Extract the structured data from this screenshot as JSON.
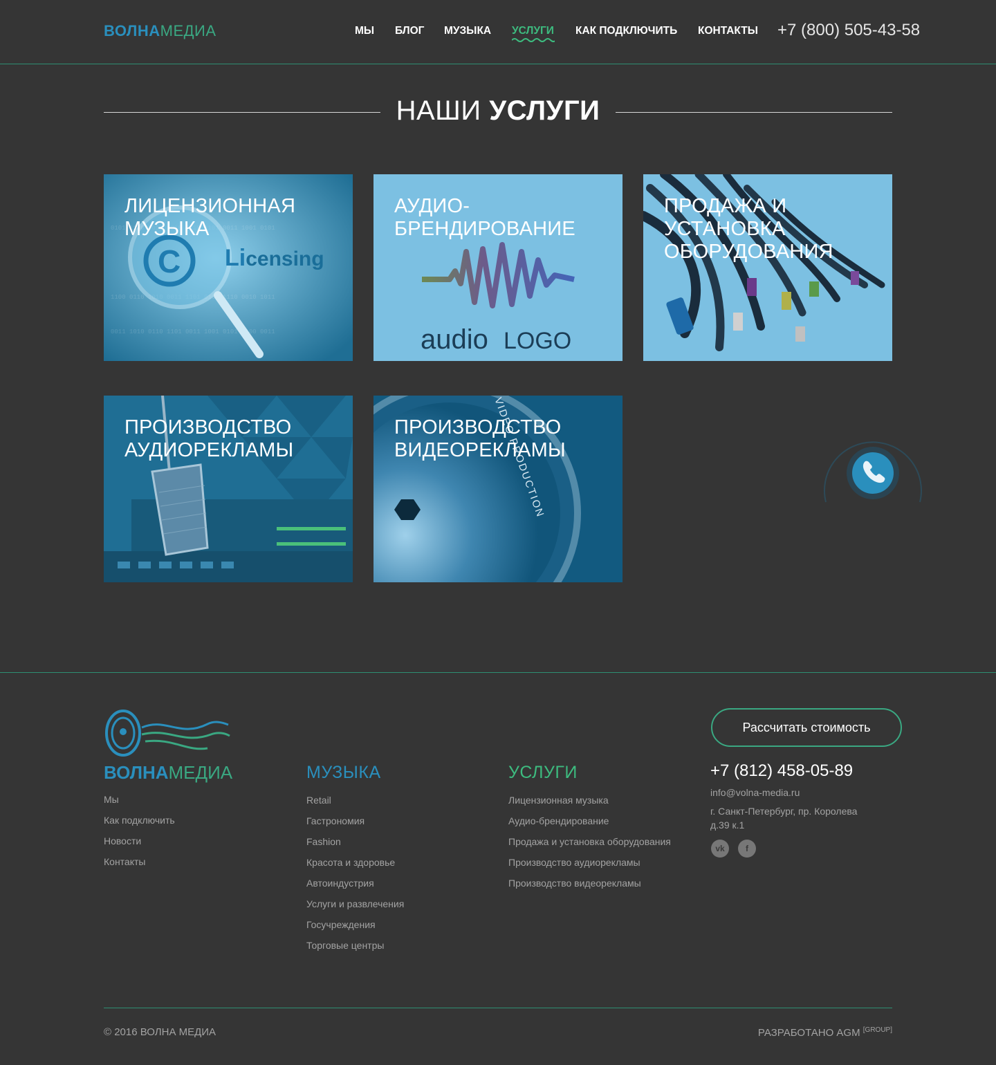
{
  "header": {
    "logo_bold": "ВОЛНА",
    "logo_light": "МЕДИА",
    "nav": [
      {
        "label": "МЫ",
        "active": false
      },
      {
        "label": "БЛОГ",
        "active": false
      },
      {
        "label": "МУЗЫКА",
        "active": false
      },
      {
        "label": "УСЛУГИ",
        "active": true
      },
      {
        "label": "КАК ПОДКЛЮЧИТЬ",
        "active": false
      },
      {
        "label": "КОНТАКТЫ",
        "active": false
      }
    ],
    "phone": "+7 (800) 505-43-58"
  },
  "section": {
    "title_light": "НАШИ",
    "title_bold": "УСЛУГИ"
  },
  "cards": [
    {
      "lines": [
        "ЛИЦЕНЗИОННАЯ",
        "МУЗЫКА"
      ],
      "image_text": "Licensing",
      "icon": "copyright-icon"
    },
    {
      "lines": [
        "АУДИО-",
        "БРЕНДИРОВАНИЕ"
      ],
      "image_text_a": "audio",
      "image_text_b": "LOGO",
      "icon": "waveform-icon"
    },
    {
      "lines": [
        "ПРОДАЖА И",
        "УСТАНОВКА",
        "ОБОРУДОВАНИЯ"
      ],
      "icon": "cables-icon"
    },
    {
      "lines": [
        "ПРОИЗВОДСТВО",
        "АУДИОРЕКЛАМЫ"
      ],
      "icon": "microphone-icon"
    },
    {
      "lines": [
        "ПРОИЗВОДСТВО",
        "ВИДЕОРЕКЛАМЫ"
      ],
      "image_text": "VIDEO PRODUCTION",
      "icon": "camera-lens-icon"
    }
  ],
  "footer": {
    "brand_bold": "ВОЛНА",
    "brand_light": "МЕДИА",
    "col1": [
      "Мы",
      "Как подключить",
      "Новости",
      "Контакты"
    ],
    "music_title": "МУЗЫКА",
    "music": [
      "Retail",
      "Гастрономия",
      "Fashion",
      "Красота и здоровье",
      "Автоиндустрия",
      "Услуги и развлечения",
      "Госучреждения",
      "Торговые центры"
    ],
    "services_title": "УСЛУГИ",
    "services": [
      "Лицензионная музыка",
      "Аудио-брендирование",
      "Продажа и установка оборудования",
      "Производство аудиорекламы",
      "Производство видеорекламы"
    ],
    "cta": "Рассчитать стоимость",
    "phone": "+7 (812) 458-05-89",
    "email": "info@volna-media.ru",
    "address": "г. Санкт-Петербург, пр. Королева д.39 к.1",
    "social": [
      "vk-icon",
      "facebook-icon"
    ],
    "social_labels": [
      "vk",
      "f"
    ],
    "copyright": "© 2016 ВОЛНА МЕДИА",
    "developer": "РАЗРАБОТАНО AGM",
    "developer_sup": "[GROUP]"
  },
  "colors": {
    "background": "#353535",
    "accent_green": "#3dbb7f",
    "accent_blue": "#2a8fbd",
    "card_light": "#7cc0e2",
    "card_dark": "#1f6e94"
  }
}
